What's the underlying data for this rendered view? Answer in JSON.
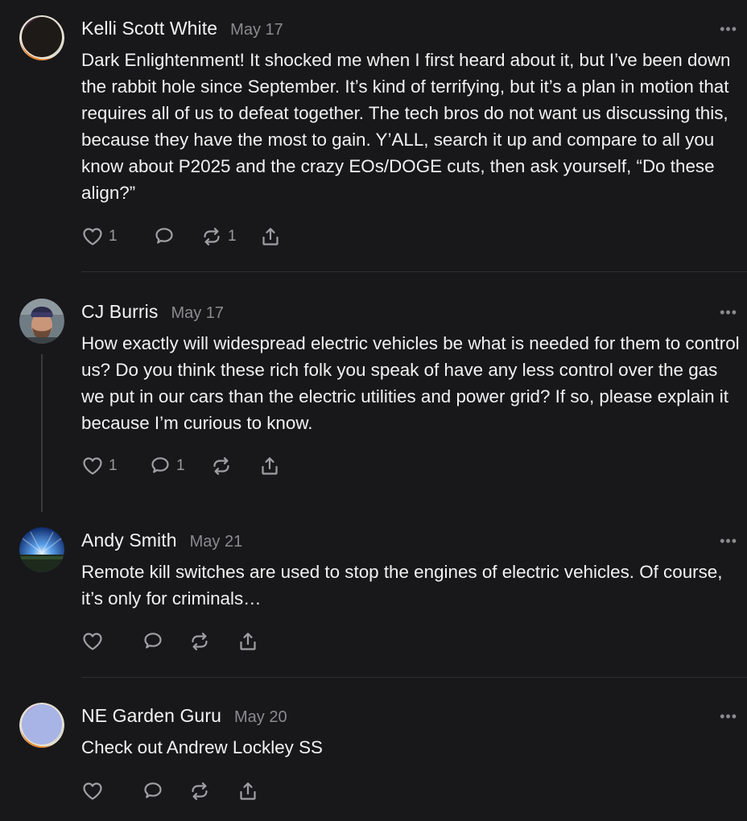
{
  "comments": [
    {
      "author": "Kelli Scott White",
      "date": "May 17",
      "text": "Dark Enlightenment! It shocked me when I first heard about it, but I’ve been down the rabbit hole since September. It’s kind of terrifying, but it’s a plan in motion that requires all of us to defeat together. The tech bros do not want us discussing this, because they have the most to gain. Y’ALL, search it up and compare to all you know about P2025 and the crazy EOs/DOGE cuts, then ask yourself, “Do these align?”",
      "likes": "1",
      "replies": "",
      "restacks": "1"
    },
    {
      "author": "CJ Burris",
      "date": "May 17",
      "text": "How exactly will widespread electric vehicles be what is needed for them to control us? Do you think these rich folk you speak of have any less control over the gas we put in our cars than the electric utilities and power grid? If so, please explain it because I’m curious to know.",
      "likes": "1",
      "replies": "1",
      "restacks": ""
    },
    {
      "author": "Andy Smith",
      "date": "May 21",
      "text": "Remote kill switches are used to stop the engines of electric vehicles. Of course, it’s only for criminals…",
      "likes": "",
      "replies": "",
      "restacks": ""
    },
    {
      "author": "NE Garden Guru",
      "date": "May 20",
      "text": "Check out Andrew Lockley SS",
      "likes": "",
      "replies": "",
      "restacks": ""
    }
  ],
  "icons": {
    "more": "more-horizontal-icon",
    "like": "heart-icon",
    "reply": "comment-bubble-icon",
    "restack": "restack-icon",
    "share": "share-icon"
  },
  "more_label": "•••",
  "colors": {
    "background": "#18181a",
    "text": "#f2f2f2",
    "muted": "#8b8b8f"
  }
}
